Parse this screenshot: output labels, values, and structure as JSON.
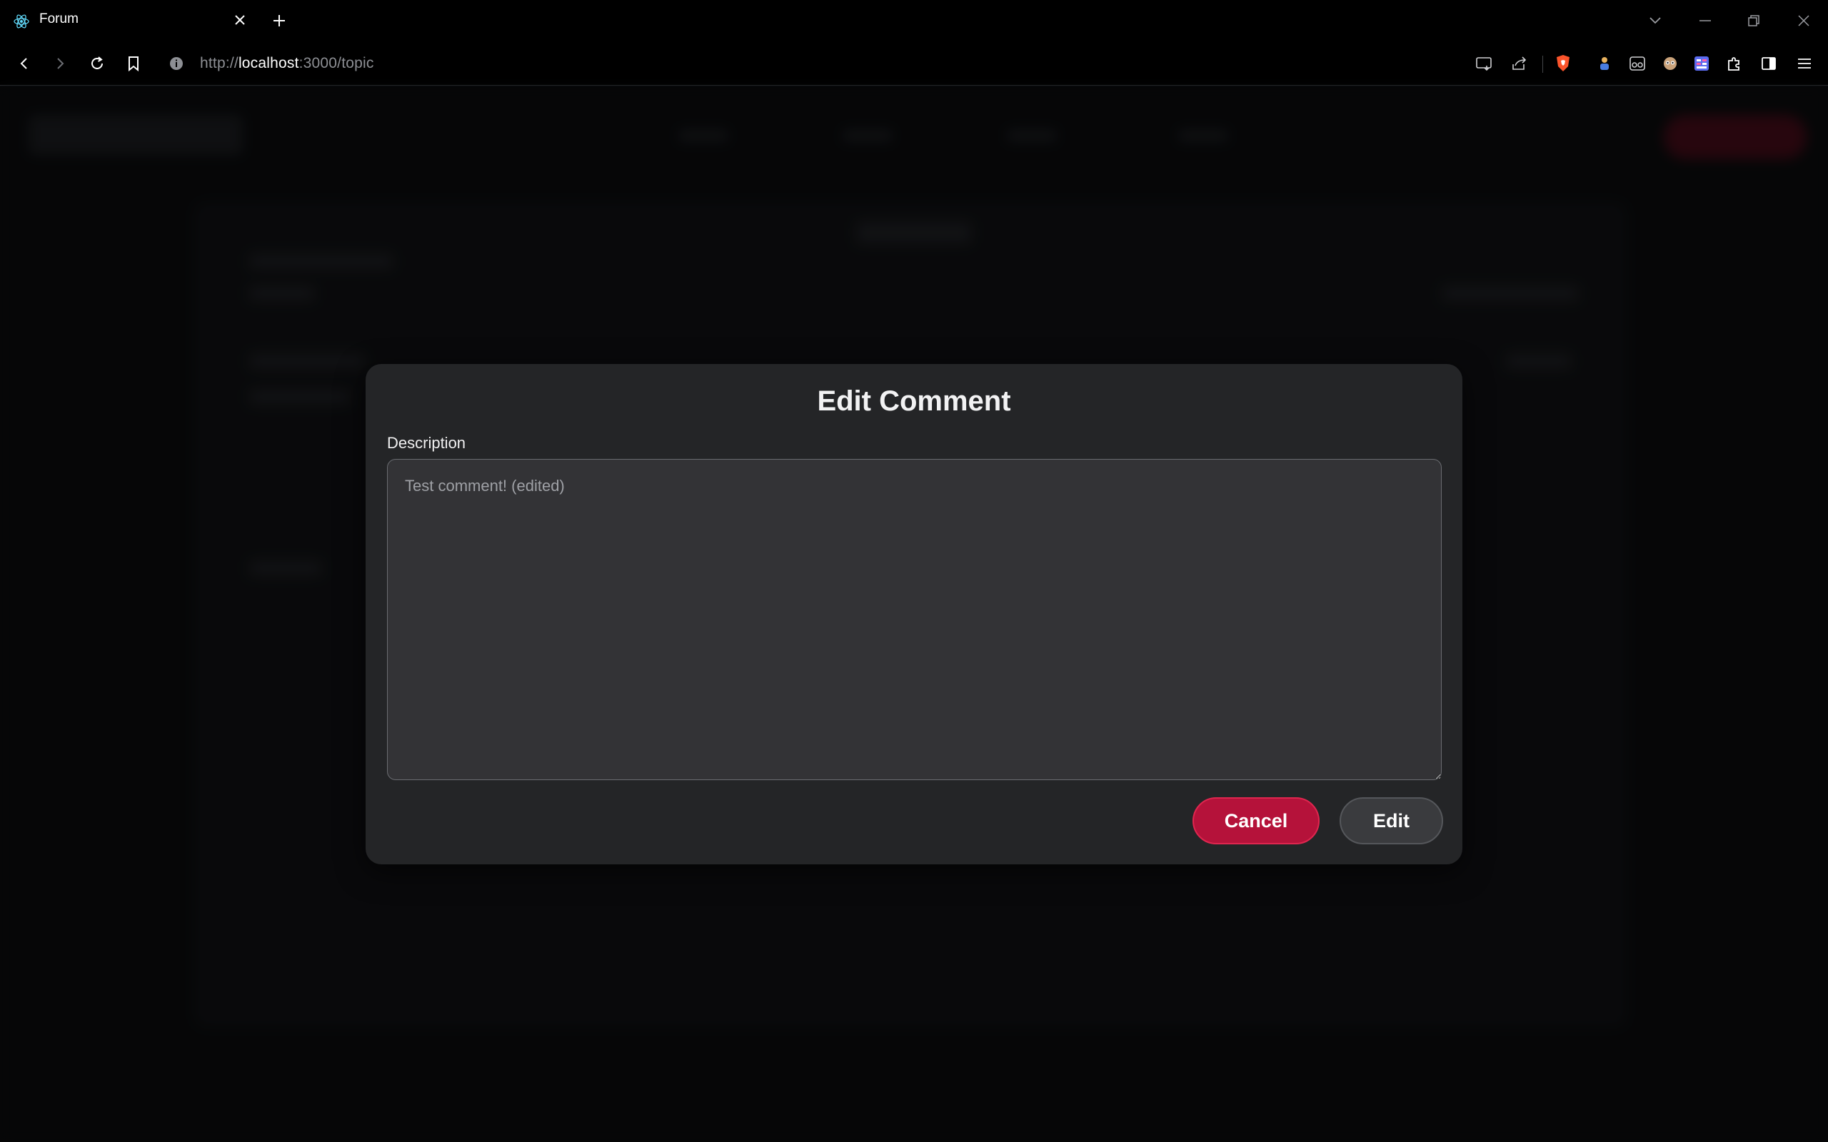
{
  "browser": {
    "tab": {
      "title": "Forum",
      "favicon": "react-atom-icon"
    },
    "address": {
      "scheme": "http://",
      "host": "localhost",
      "rest": ":3000/topic"
    }
  },
  "modal": {
    "title": "Edit Comment",
    "field_label": "Description",
    "textarea_value": "Test comment! (edited)",
    "cancel_label": "Cancel",
    "edit_label": "Edit"
  },
  "colors": {
    "accent_red": "#b5123a",
    "modal_bg": "#242527",
    "page_bg": "#0b0c0e"
  }
}
